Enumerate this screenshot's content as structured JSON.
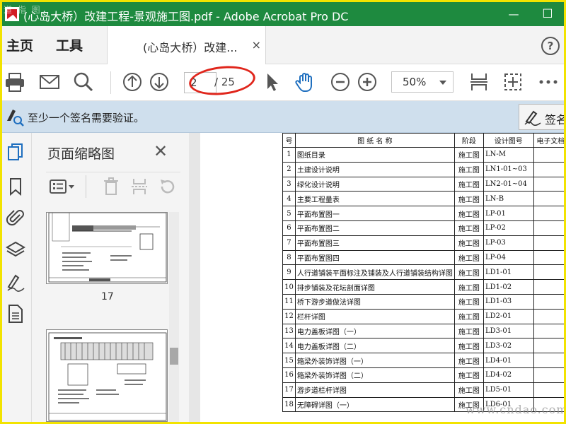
{
  "window": {
    "title": "(心岛大桥）改建工程-景观施工图.pdf - Adobe Acrobat Pro DC",
    "minimize": "—",
    "maximize": "☐",
    "watermark_top": "道 指 图"
  },
  "menubar": {
    "home": "主页",
    "tools": "工具",
    "tab_label": "(心岛大桥）改建...",
    "tab_close": "×",
    "help": "?"
  },
  "toolbar": {
    "current_page": "2",
    "page_total": "/ 25",
    "zoom": "50%"
  },
  "signature_bar": {
    "message": "至少一个签名需要验证。",
    "button_label": "签名"
  },
  "thumbnail_panel": {
    "title": "页面缩略图",
    "close": "✕",
    "pages": [
      "17"
    ]
  },
  "document_table": {
    "headers": [
      "号",
      "图 纸 名 称",
      "阶段",
      "设计图号",
      "电子文档"
    ],
    "rows": [
      [
        "1",
        "图纸目录",
        "施工图",
        "LN-M"
      ],
      [
        "2",
        "土建设计说明",
        "施工图",
        "LN1-01~03"
      ],
      [
        "3",
        "绿化设计说明",
        "施工图",
        "LN2-01~04"
      ],
      [
        "4",
        "主要工程量表",
        "施工图",
        "LN-B"
      ],
      [
        "5",
        "平面布置图一",
        "施工图",
        "LP-01"
      ],
      [
        "6",
        "平面布置图二",
        "施工图",
        "LP-02"
      ],
      [
        "7",
        "平面布置图三",
        "施工图",
        "LP-03"
      ],
      [
        "8",
        "平面布置图四",
        "施工图",
        "LP-04"
      ],
      [
        "9",
        "人行道铺装平面标注及铺装及人行道铺装结构详图",
        "施工图",
        "LD1-01"
      ],
      [
        "10",
        "排步铺装及花坛剖面详图",
        "施工图",
        "LD1-02"
      ],
      [
        "11",
        "桥下游步道做法详图",
        "施工图",
        "LD1-03"
      ],
      [
        "12",
        "栏杆详图",
        "施工图",
        "LD2-01"
      ],
      [
        "13",
        "电力盖板详图（一）",
        "施工图",
        "LD3-01"
      ],
      [
        "14",
        "电力盖板详图（二）",
        "施工图",
        "LD3-02"
      ],
      [
        "15",
        "箱梁外装饰详图（一）",
        "施工图",
        "LD4-01"
      ],
      [
        "16",
        "箱梁外装饰详图（二）",
        "施工图",
        "LD4-02"
      ],
      [
        "17",
        "游步道栏杆详图",
        "施工图",
        "LD5-01"
      ],
      [
        "18",
        "无障碍详图（一）",
        "施工图",
        "LD6-01"
      ]
    ]
  },
  "watermark_bottom": "www.cndao.com",
  "colors": {
    "titlebar": "#1e8a3f",
    "border": "#f2e300",
    "annotation": "#e0261c",
    "sigbar": "#cfdfed"
  }
}
